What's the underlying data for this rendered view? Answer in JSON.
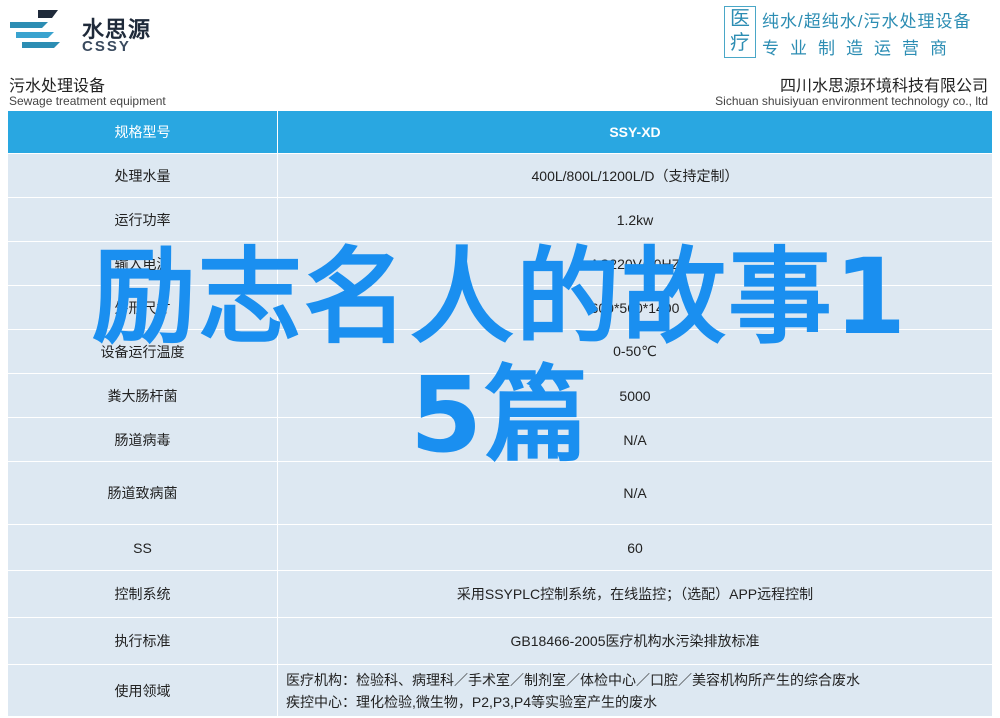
{
  "brand": {
    "logo_cn": "水思源",
    "logo_en": "CSSY",
    "badge": "医疗",
    "tagline_1": "纯水/超纯水/污水处理设备",
    "tagline_2": "专业制造运营商",
    "accent_color": "#29a7e1"
  },
  "subheader": {
    "left_cn": "污水处理设备",
    "left_en": "Sewage treatment equipment",
    "right_cn": "四川水思源环境科技有限公司",
    "right_en": "Sichuan shuisiyuan environment technology co., ltd"
  },
  "table": {
    "header": {
      "label": "规格型号",
      "value": "SSY-XD"
    },
    "rows": [
      {
        "label": "处理水量",
        "value": "400L/800L/1200L/D（支持定制）"
      },
      {
        "label": "运行功率",
        "value": "1.2kw"
      },
      {
        "label": "输入电源",
        "value": "AC220V/50HZ"
      },
      {
        "label": "外形尺寸",
        "value": "600*560*1400"
      },
      {
        "label": "设备运行温度",
        "value": "0-50℃"
      },
      {
        "label": "粪大肠杆菌",
        "value": "5000"
      },
      {
        "label": "肠道病毒",
        "value": "N/A"
      },
      {
        "label": "肠道致病菌",
        "value": "N/A"
      },
      {
        "label": "SS",
        "value": "60"
      },
      {
        "label": "控制系统",
        "value": "采用SSYPLC控制系统，在线监控；（选配）APP远程控制"
      },
      {
        "label": "执行标准",
        "value": "GB18466-2005医疗机构水污染排放标准"
      },
      {
        "label": "使用领域",
        "value_line1": "医疗机构：检验科、病理科／手术室／制剂室／体检中心／口腔／美容机构所产生的综合废水",
        "value_line2": "疾控中心：理化检验,微生物，P2,P3,P4等实验室产生的废水"
      }
    ]
  },
  "overlay": {
    "line1": "励志名人的故事1",
    "line2": "5篇"
  }
}
